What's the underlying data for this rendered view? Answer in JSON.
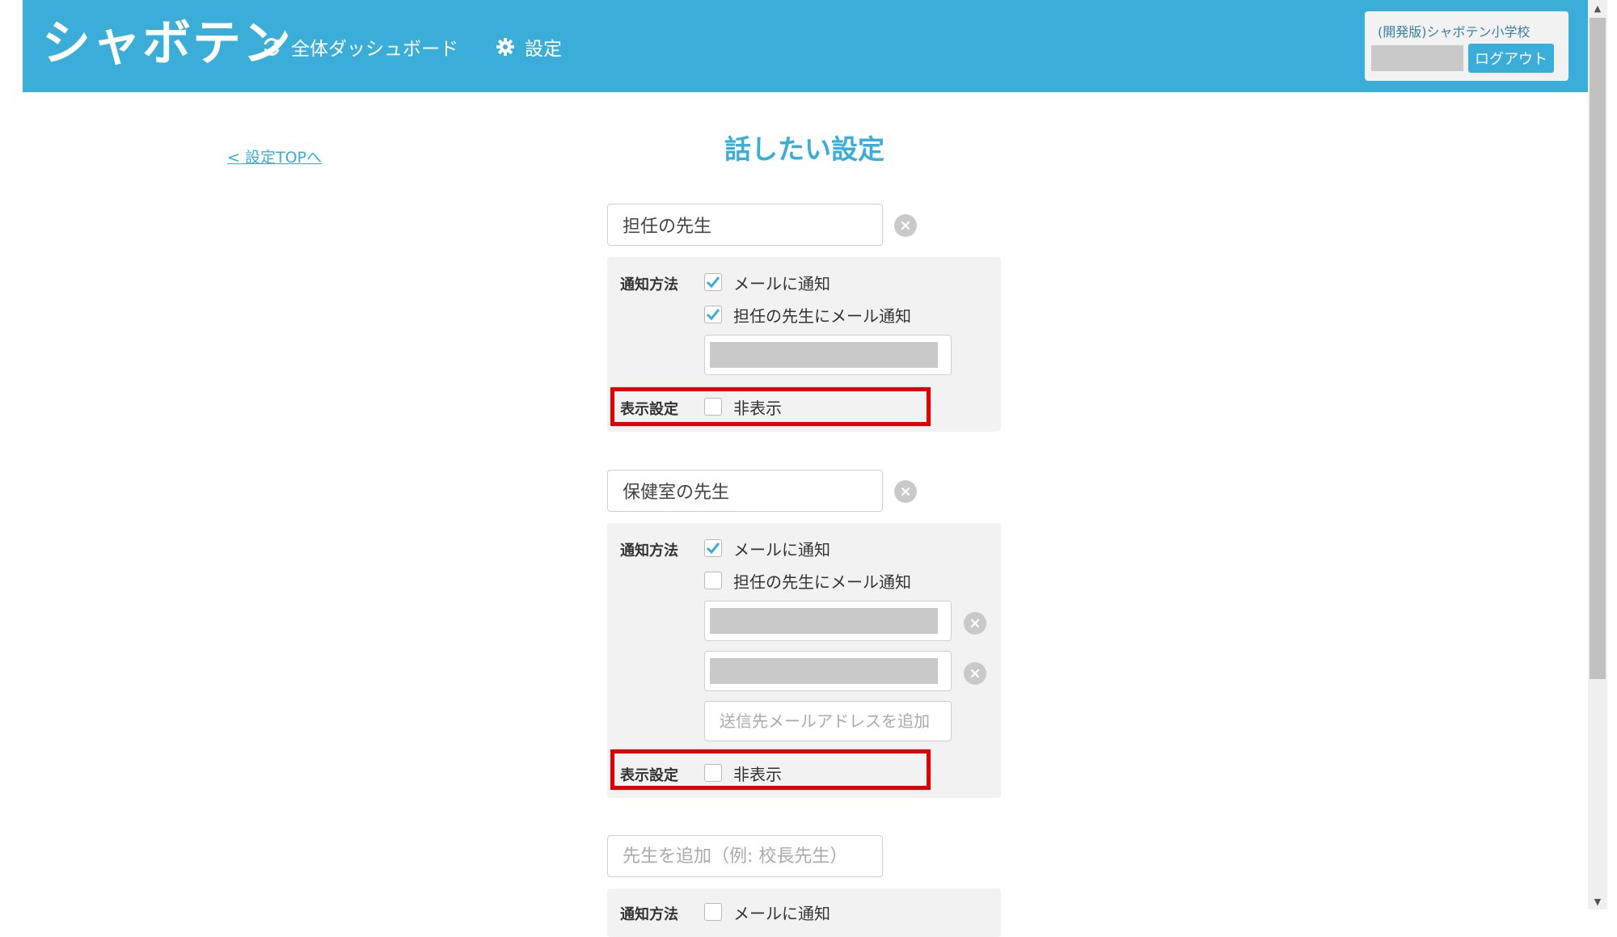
{
  "header": {
    "logo": "シャボテン",
    "nav": [
      {
        "label": "全体ダッシュボード",
        "icon": "refresh-icon"
      },
      {
        "label": "設定",
        "icon": "gear-icon"
      }
    ],
    "school_name": "(開発版)シャボテン小学校",
    "logout_label": "ログアウト"
  },
  "back_link": "< 設定TOPへ",
  "page_title": "話したい設定",
  "teachers": [
    {
      "name": "担任の先生",
      "notify_label": "通知方法",
      "notify_email_label": "メールに通知",
      "notify_email_checked": true,
      "notify_homeroom_label": "担任の先生にメール通知",
      "notify_homeroom_checked": true,
      "display_label": "表示設定",
      "hide_label": "非表示",
      "hide_checked": false
    },
    {
      "name": "保健室の先生",
      "notify_label": "通知方法",
      "notify_email_label": "メールに通知",
      "notify_email_checked": true,
      "notify_homeroom_label": "担任の先生にメール通知",
      "notify_homeroom_checked": false,
      "add_email_placeholder": "送信先メールアドレスを追加",
      "display_label": "表示設定",
      "hide_label": "非表示",
      "hide_checked": false
    }
  ],
  "new_teacher": {
    "placeholder": "先生を追加（例: 校長先生）",
    "notify_label": "通知方法",
    "notify_email_label": "メールに通知"
  },
  "colors": {
    "accent": "#3aadd9",
    "panel_bg": "#f2f2f2",
    "highlight": "#e00000"
  }
}
